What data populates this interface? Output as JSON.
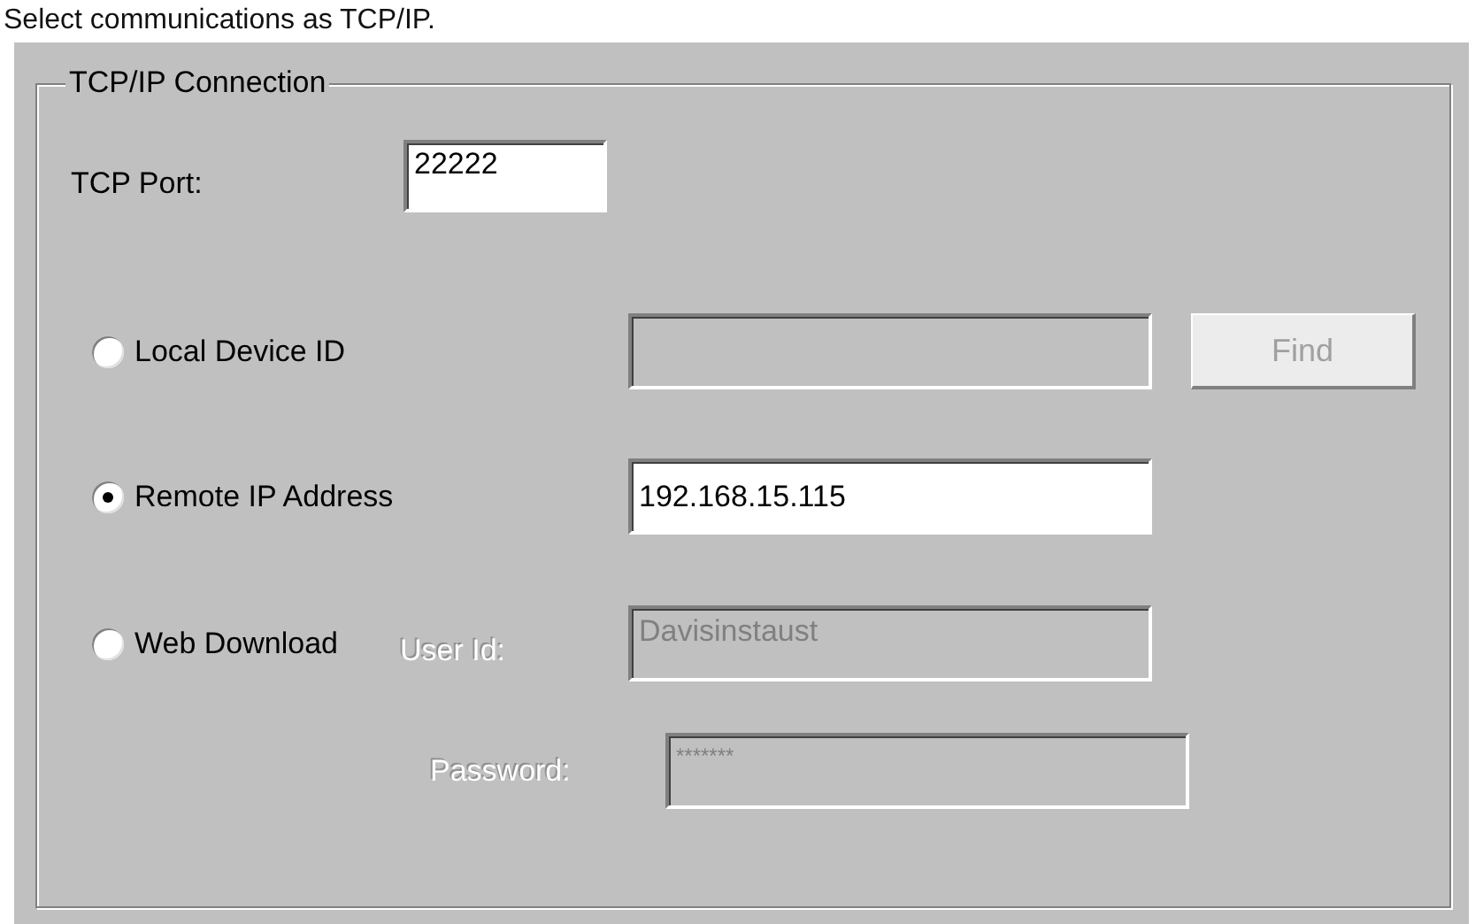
{
  "caption": "Select communications as TCP/IP.",
  "group": {
    "title": "TCP/IP Connection",
    "port": {
      "label": "TCP Port:",
      "value": "22222"
    },
    "options": [
      {
        "kind": "device",
        "label": "Local Device ID",
        "selected": false,
        "disabled": true,
        "button": {
          "label": "Find",
          "disabled": true
        }
      },
      {
        "kind": "address",
        "label": "Remote IP Address",
        "selected": true,
        "disabled": false,
        "value": "192.168.15.115"
      },
      {
        "kind": "web",
        "label": "Web Download",
        "selected": false,
        "disabled": true,
        "user_label": "User Id:",
        "user_value": "Davisinstaust",
        "password_label": "Password:",
        "password_value": "*******"
      }
    ]
  }
}
